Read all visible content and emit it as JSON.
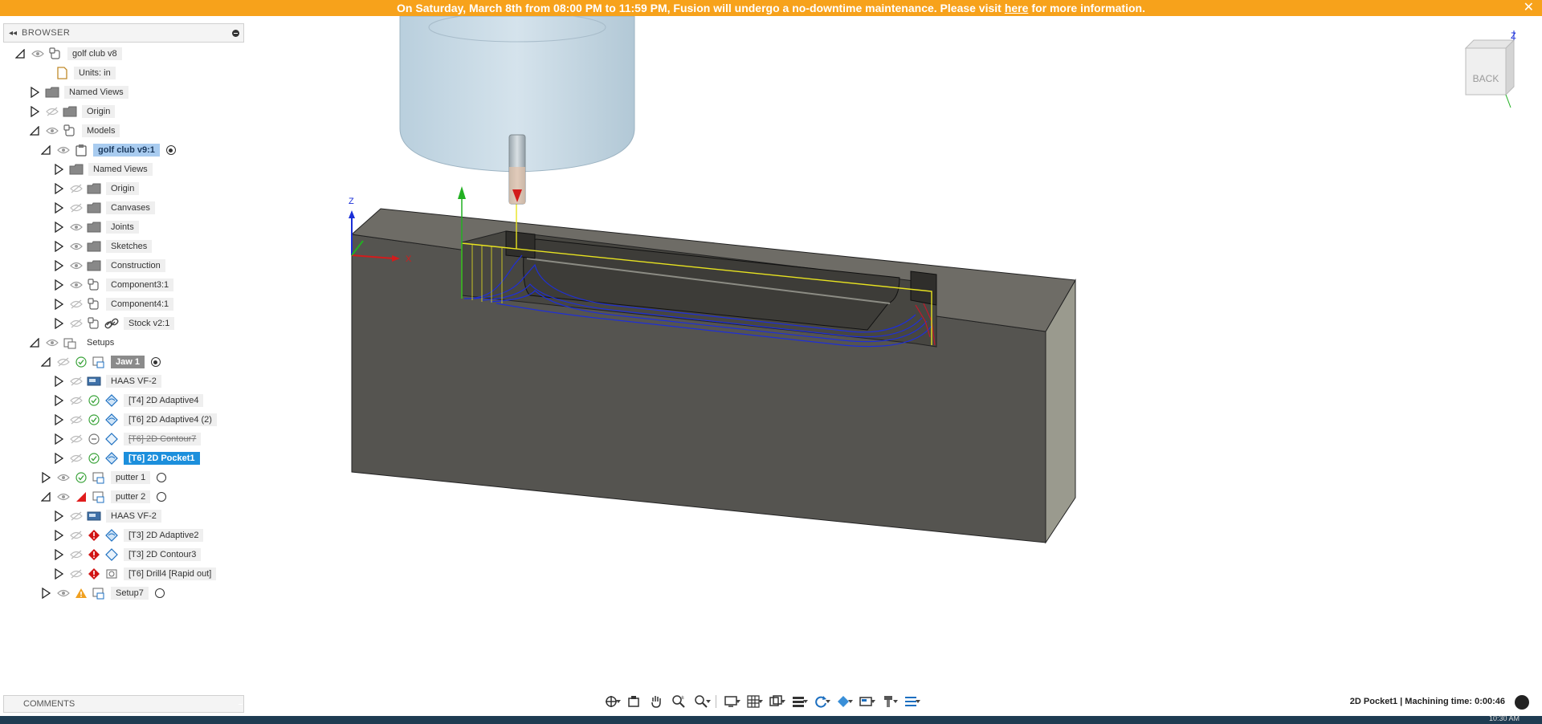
{
  "banner": {
    "text_before": "On Saturday, March 8th from 08:00 PM to 11:59 PM, Fusion will undergo a no-downtime maintenance. Please visit",
    "link": "here",
    "text_after": "for more information.",
    "close": "✕"
  },
  "browser": {
    "collapse_icon": "◂◂",
    "title": "BROWSER"
  },
  "tree": [
    {
      "label": "golf club v8"
    },
    {
      "label": "Units: in"
    },
    {
      "label": "Named Views"
    },
    {
      "label": "Origin"
    },
    {
      "label": "Models"
    },
    {
      "label": "golf club v9:1"
    },
    {
      "label": "Named Views"
    },
    {
      "label": "Origin"
    },
    {
      "label": "Canvases"
    },
    {
      "label": "Joints"
    },
    {
      "label": "Sketches"
    },
    {
      "label": "Construction"
    },
    {
      "label": "Component3:1"
    },
    {
      "label": "Component4:1"
    },
    {
      "label": "Stock v2:1"
    },
    {
      "label": "Setups"
    },
    {
      "label": "Jaw 1"
    },
    {
      "label": "HAAS VF-2"
    },
    {
      "label": "[T4] 2D Adaptive4"
    },
    {
      "label": "[T6] 2D Adaptive4 (2)"
    },
    {
      "label": "[T6] 2D Contour7"
    },
    {
      "label": "[T6] 2D Pocket1"
    },
    {
      "label": "putter 1"
    },
    {
      "label": "putter 2"
    },
    {
      "label": "HAAS VF-2"
    },
    {
      "label": "[T3] 2D Adaptive2"
    },
    {
      "label": "[T3] 2D Contour3"
    },
    {
      "label": "[T6] Drill4 [Rapid out]"
    },
    {
      "label": "Setup7"
    }
  ],
  "comments": {
    "title": "COMMENTS"
  },
  "viewcube": {
    "face": "BACK",
    "axis": "Z"
  },
  "viewport": {
    "axis_z": "Z",
    "axis_x": "X"
  },
  "status": {
    "text": "2D Pocket1 | Machining time: 0:00:46"
  },
  "taskbar": {
    "clock": "10:30 AM"
  },
  "colors": {
    "banner": "#f7a21b",
    "selection": "#1c8fdc",
    "stock": "#5a5853",
    "toolpath": "#1f2fd6",
    "boundary": "#e8e320"
  }
}
